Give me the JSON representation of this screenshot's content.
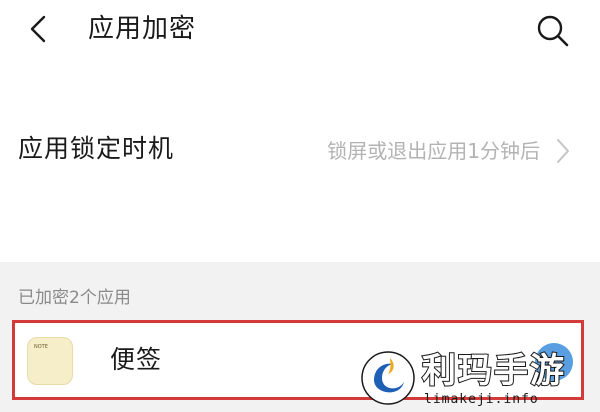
{
  "header": {
    "title": "应用加密",
    "back_icon": "chevron-left-icon",
    "search_icon": "search-icon"
  },
  "lock_timing": {
    "label": "应用锁定时机",
    "value": "锁屏或退出应用1分钟后",
    "chevron_icon": "chevron-right-icon"
  },
  "encrypted_apps": {
    "section_label": "已加密2个应用",
    "items": [
      {
        "name": "便签",
        "icon_text": "NOTE"
      }
    ],
    "highlight_color": "#d33a3a"
  },
  "watermark": {
    "title": "利玛手游",
    "url": "limakeji.info"
  },
  "colors": {
    "background": "#f2f2f2",
    "card": "#ffffff",
    "secondary_text": "#b3b3b3",
    "toggle_accent": "#3b8ddb"
  }
}
